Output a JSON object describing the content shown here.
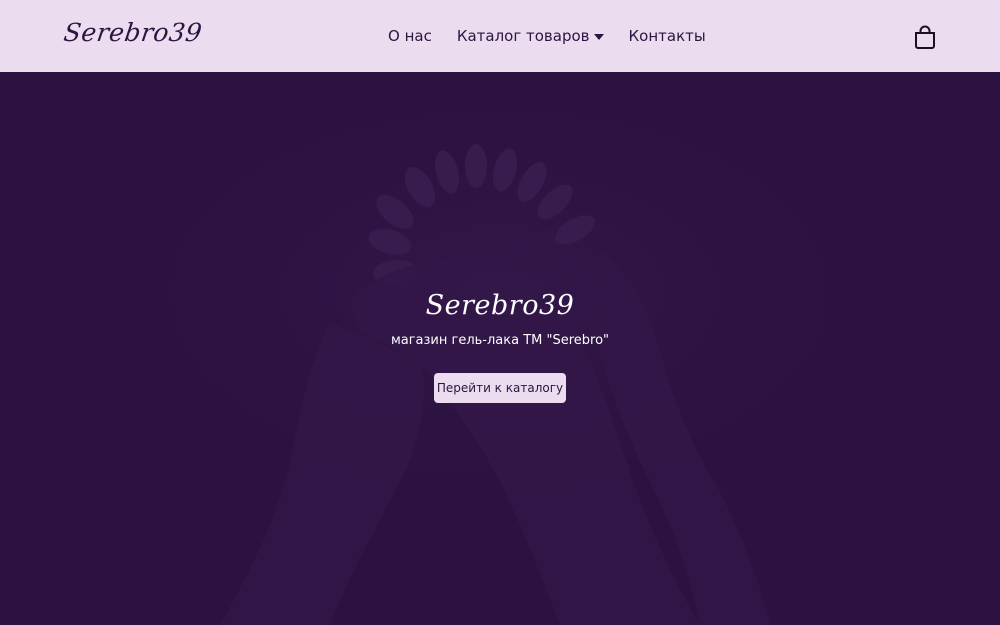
{
  "navbar": {
    "logo": "Serebro39",
    "links": [
      {
        "label": "О нас"
      },
      {
        "label": "Каталог товаров"
      },
      {
        "label": "Контакты"
      }
    ],
    "cart_icon": "shopping-bag-icon"
  },
  "hero": {
    "title": "Serebro39",
    "subtitle": "магазин гель-лака ТМ \"Serebro\"",
    "button_label": "Перейти к каталогу"
  },
  "colors": {
    "navbar_bg": "#ecdcef",
    "hero_bg": "#2b1240",
    "text_dark": "#2a1640"
  }
}
